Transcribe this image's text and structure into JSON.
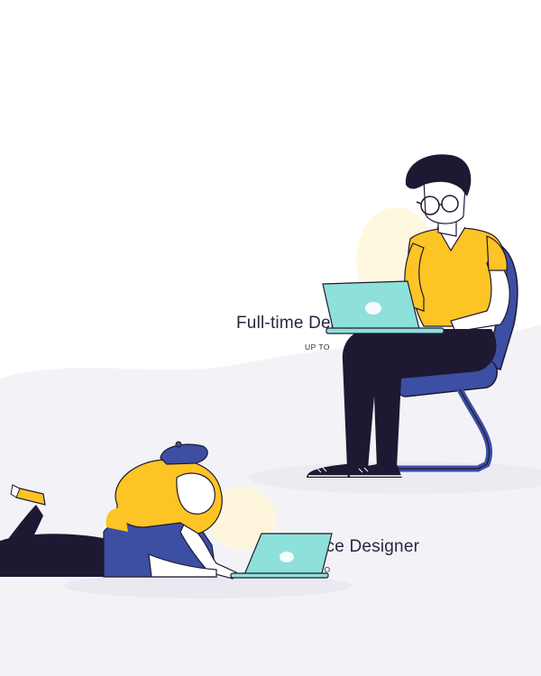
{
  "fulltime": {
    "title": "Full-time Des",
    "sub": "UP TO"
  },
  "freelance": {
    "title": "ance Designer",
    "sub": "TO"
  },
  "colors": {
    "background": "#ffffff",
    "wave": "#f4f4f8",
    "shirt_yellow": "#fdc425",
    "laptop": "#8ee0da",
    "pants": "#1e1833",
    "chair": "#3d4fa3",
    "hair_dark": "#1e1833",
    "hair_blonde": "#fdc425",
    "beret": "#3d4fa3",
    "skin": "#ffffff"
  }
}
